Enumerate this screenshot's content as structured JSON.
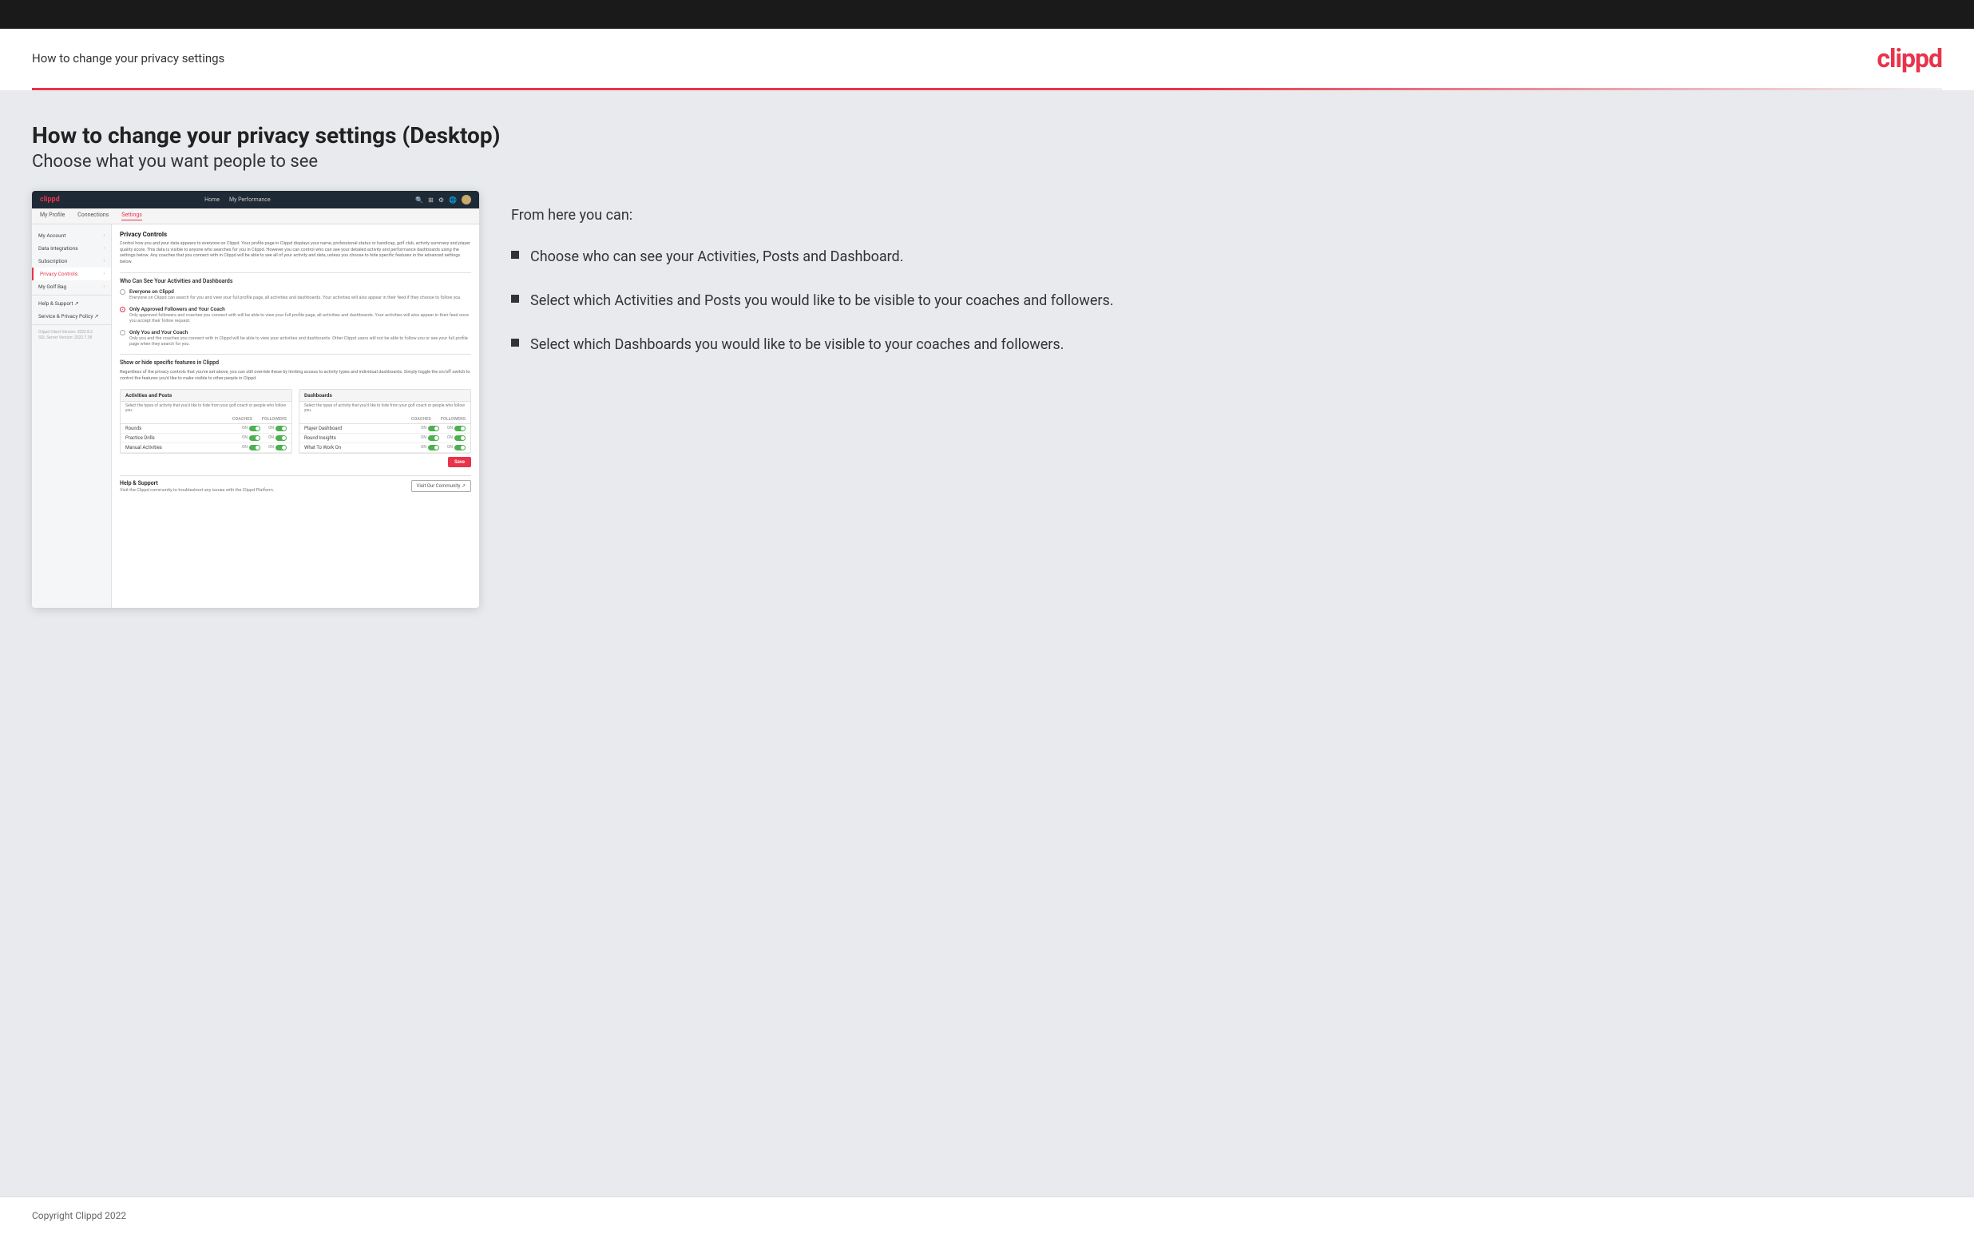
{
  "header": {
    "title": "How to change your privacy settings",
    "logo": "clippd"
  },
  "page": {
    "heading_bold": "How to change your privacy settings (Desktop)",
    "heading_light": "Choose what you want people to see"
  },
  "mockup": {
    "nav": {
      "logo": "clippd",
      "links": [
        "Home",
        "My Performance"
      ],
      "icons": [
        "search",
        "grid",
        "settings",
        "globe",
        "avatar"
      ]
    },
    "subnav": {
      "items": [
        {
          "label": "My Profile",
          "active": false
        },
        {
          "label": "Connections",
          "active": false
        },
        {
          "label": "Settings",
          "active": true
        }
      ]
    },
    "sidebar": {
      "items": [
        {
          "label": "My Account",
          "active": false,
          "chevron": true
        },
        {
          "label": "Data Integrations",
          "active": false,
          "chevron": true
        },
        {
          "label": "Subscription",
          "active": false,
          "chevron": true
        },
        {
          "label": "Privacy Controls",
          "active": true,
          "chevron": true
        },
        {
          "label": "My Golf Bag",
          "active": false,
          "chevron": true
        },
        {
          "label": "Help & Support ↗",
          "active": false
        },
        {
          "label": "Service & Privacy Policy ↗",
          "active": false
        }
      ],
      "version": "Clippd Client Version: 2022.8.2\nSQL Server Version: 2022.7.38"
    },
    "main": {
      "privacy_controls": {
        "title": "Privacy Controls",
        "description": "Control how you and your data appears to everyone on Clippd. Your profile page in Clippd displays your name, professional status or handicap, golf club, activity summary and player quality score. This data is visible to anyone who searches for you in Clippd. However you can control who can see your detailed activity and performance dashboards using the settings below. Any coaches that you connect with in Clippd will be able to see all of your activity and data, unless you choose to hide specific features in the advanced settings below."
      },
      "who_can_see": {
        "title": "Who Can See Your Activities and Dashboards",
        "options": [
          {
            "id": "everyone",
            "label": "Everyone on Clippd",
            "description": "Everyone on Clippd can search for you and view your full profile page, all activities and dashboards. Your activities will also appear in their feed if they choose to follow you.",
            "selected": false
          },
          {
            "id": "followers",
            "label": "Only Approved Followers and Your Coach",
            "description": "Only approved followers and coaches you connect with will be able to view your full profile page, all activities and dashboards. Your activities will also appear in their feed once you accept their follow request.",
            "selected": true
          },
          {
            "id": "coach_only",
            "label": "Only You and Your Coach",
            "description": "Only you and the coaches you connect with in Clippd will be able to view your activities and dashboards. Other Clippd users will not be able to follow you or see your full profile page when they search for you.",
            "selected": false
          }
        ]
      },
      "show_hide": {
        "title": "Show or hide specific features in Clippd",
        "description": "Regardless of the privacy controls that you've set above, you can still override these by limiting access to activity types and individual dashboards. Simply toggle the on/off switch to control the features you'd like to make visible to other people in Clippd."
      },
      "activities_posts": {
        "title": "Activities and Posts",
        "description": "Select the types of activity that you'd like to hide from your golf coach or people who follow you.",
        "rows": [
          {
            "label": "Rounds"
          },
          {
            "label": "Practice Drills"
          },
          {
            "label": "Manual Activities"
          }
        ]
      },
      "dashboards": {
        "title": "Dashboards",
        "description": "Select the types of activity that you'd like to hide from your golf coach or people who follow you.",
        "rows": [
          {
            "label": "Player Dashboard"
          },
          {
            "label": "Round Insights"
          },
          {
            "label": "What To Work On"
          }
        ]
      },
      "save_label": "Save",
      "help": {
        "title": "Help & Support",
        "description": "Visit the Clippd community to troubleshoot any issues with the Clippd Platform.",
        "button": "Visit Our Community ↗"
      }
    }
  },
  "info": {
    "intro": "From here you can:",
    "bullets": [
      {
        "text": "Choose who can see your Activities, Posts and Dashboard."
      },
      {
        "text": "Select which Activities and Posts you would like to be visible to your coaches and followers."
      },
      {
        "text": "Select which Dashboards you would like to be visible to your coaches and followers."
      }
    ]
  },
  "footer": {
    "copyright": "Copyright Clippd 2022"
  }
}
